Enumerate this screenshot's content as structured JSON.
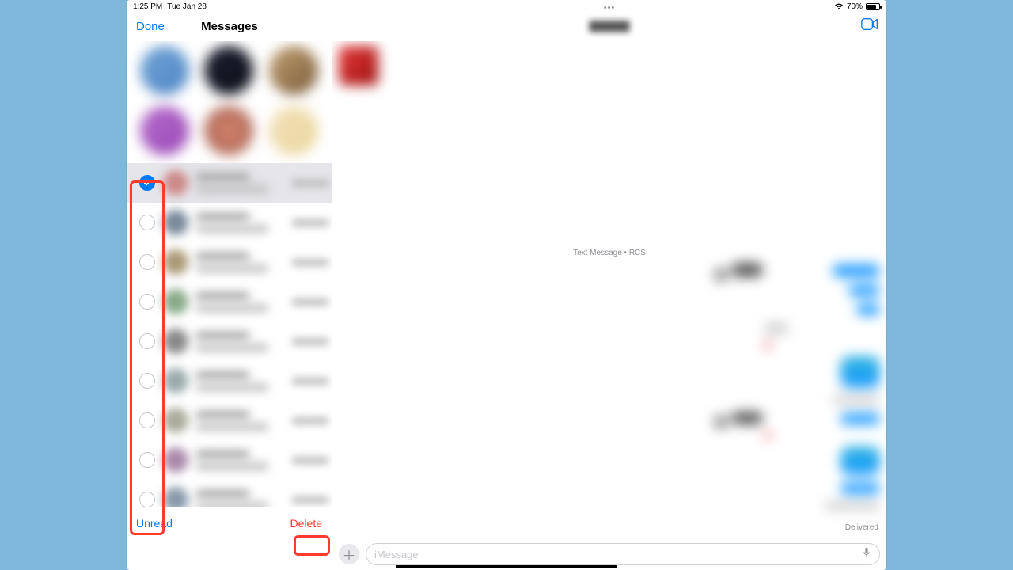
{
  "status": {
    "time": "1:25 PM",
    "date": "Tue Jan 28",
    "battery_pct": "70%"
  },
  "sidebar": {
    "done_label": "Done",
    "title": "Messages",
    "footer": {
      "unread_label": "Unread",
      "delete_label": "Delete"
    },
    "conversations": [
      {
        "selected": true
      },
      {
        "selected": false
      },
      {
        "selected": false
      },
      {
        "selected": false
      },
      {
        "selected": false
      },
      {
        "selected": false
      },
      {
        "selected": false
      },
      {
        "selected": false
      },
      {
        "selected": false
      }
    ]
  },
  "main": {
    "mid_label": "Text Message • RCS",
    "delivered_label": "Delivered",
    "input_placeholder": "iMessage"
  }
}
